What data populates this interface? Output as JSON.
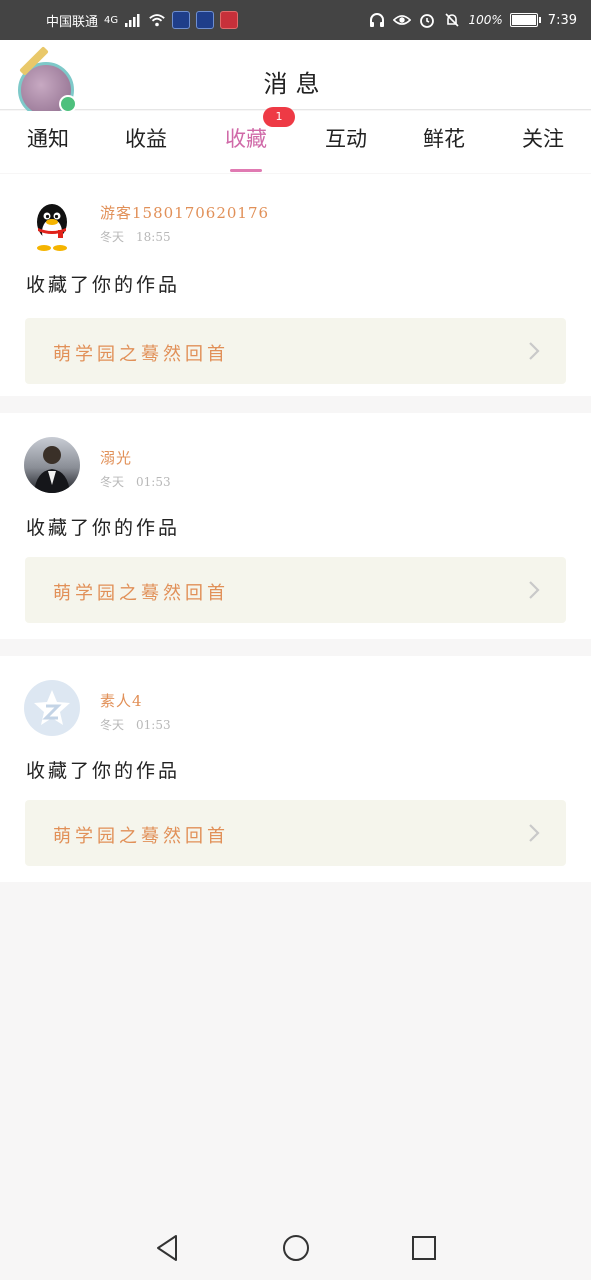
{
  "status_bar": {
    "carrier": "中国联通",
    "network": "4G",
    "battery": "100%",
    "time": "7:39"
  },
  "header": {
    "title": "消息"
  },
  "tabs": [
    {
      "label": "通知",
      "active": false
    },
    {
      "label": "收益",
      "active": false
    },
    {
      "label": "收藏",
      "active": true,
      "badge": "1"
    },
    {
      "label": "互动",
      "active": false
    },
    {
      "label": "鲜花",
      "active": false
    },
    {
      "label": "关注",
      "active": false
    }
  ],
  "messages": [
    {
      "name": "游客15801706201​76",
      "date": "冬天",
      "time": "18:55",
      "action": "收藏了你的作品",
      "work_title": "萌学园之蓦然回首"
    },
    {
      "name": "溺光",
      "date": "冬天",
      "time": "01:53",
      "action": "收藏了你的作品",
      "work_title": "萌学园之蓦然回首"
    },
    {
      "name": "素人4",
      "date": "冬天",
      "time": "01:53",
      "action": "收藏了你的作品",
      "work_title": "萌学园之蓦然回首"
    }
  ],
  "colors": {
    "accent_pink": "#d06aa8",
    "name_orange": "#e19058",
    "badge_red": "#ee3a45",
    "card_bg": "#f5f5ec"
  }
}
